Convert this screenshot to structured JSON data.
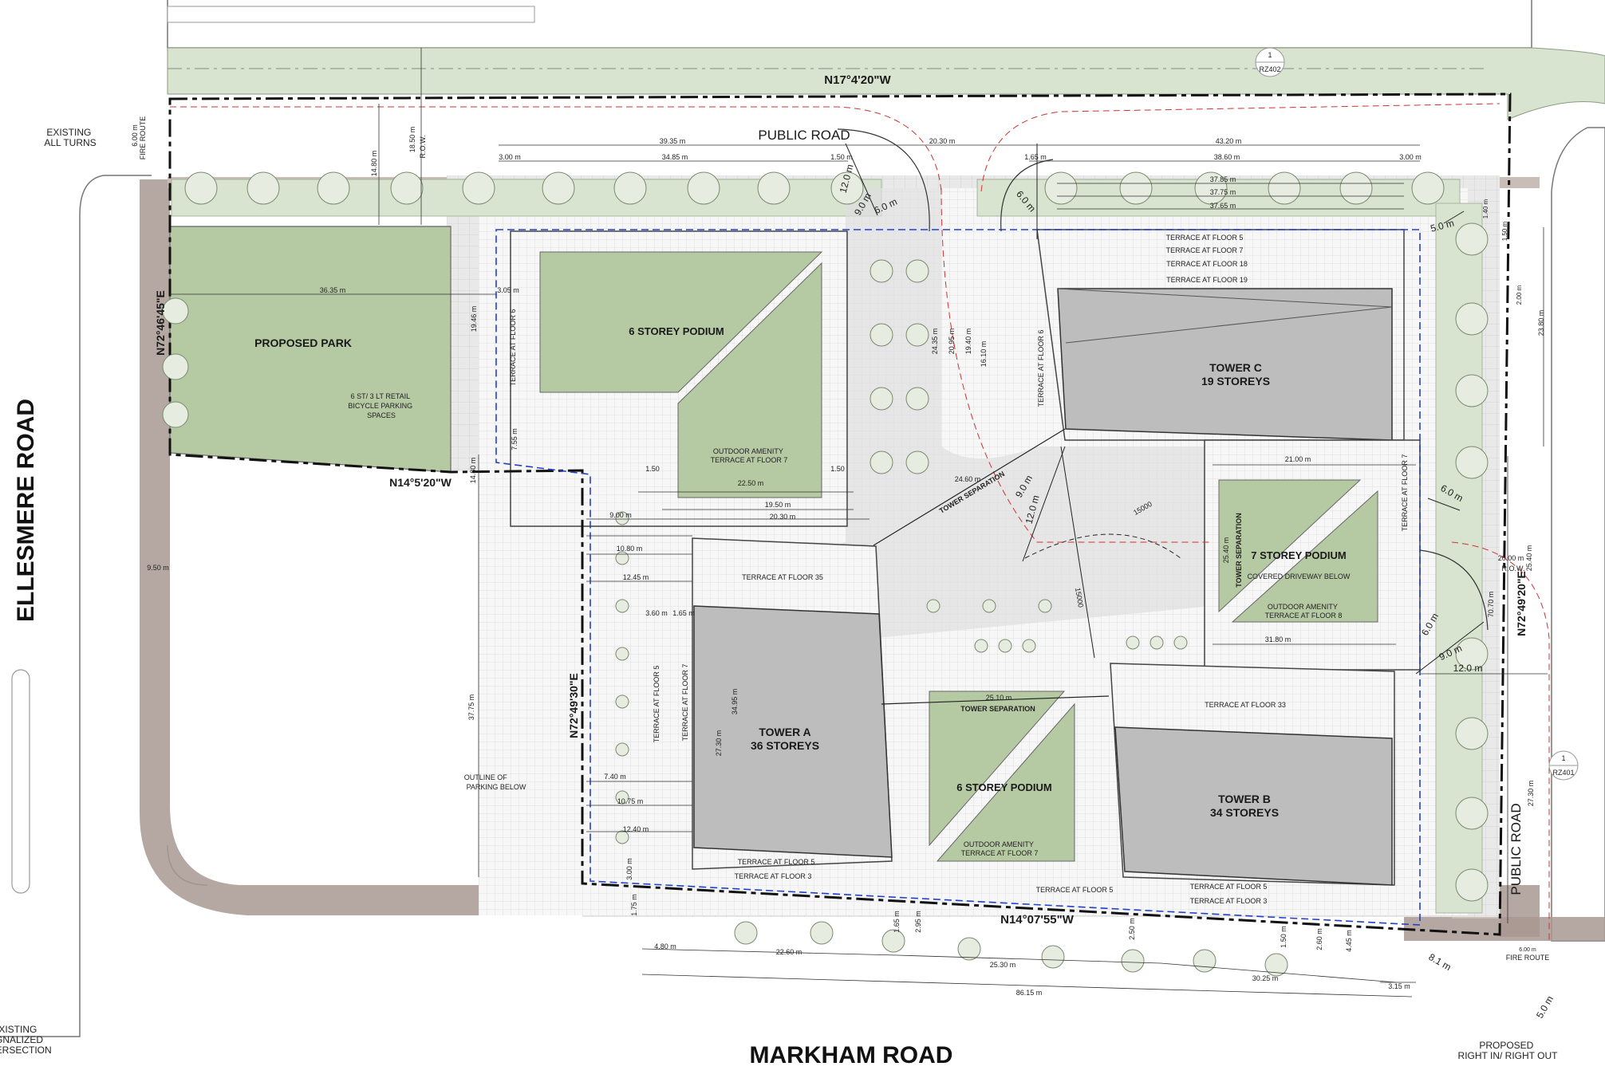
{
  "roads": {
    "west": "ELLESMERE ROAD",
    "south": "MARKHAM ROAD",
    "north": "PUBLIC ROAD",
    "east": "PUBLIC ROAD"
  },
  "bearings": {
    "north": "N17°4'20\"W",
    "south": "N14°07'55\"W",
    "park_south": "N14°5'20\"W",
    "park_west": "N72°46'45\"E",
    "west_inner": "N72°49'30\"E",
    "east": "N72°49'20\"E"
  },
  "notes": {
    "existing_all_turns": [
      "EXISTING",
      "ALL TURNS"
    ],
    "existing_signalized": [
      "EXISTING",
      "SIGNALIZED",
      "INTERSECTION"
    ],
    "proposed_right": [
      "PROPOSED",
      "RIGHT IN/ RIGHT OUT"
    ],
    "bike_parking": [
      "6 ST/ 3 LT RETAIL",
      "BICYCLE PARKING",
      "SPACES"
    ],
    "outline_parking": [
      "OUTLINE OF",
      "PARKING BELOW"
    ],
    "fire_route": "FIRE ROUTE",
    "row": "R.O.W."
  },
  "park": {
    "label": "PROPOSED PARK"
  },
  "tower_a": {
    "name": "TOWER A",
    "storeys": "36 STOREYS"
  },
  "tower_b": {
    "name": "TOWER B",
    "storeys": "34 STOREYS"
  },
  "tower_c": {
    "name": "TOWER C",
    "storeys": "19 STOREYS"
  },
  "podium_nw": {
    "label": "6 STOREY PODIUM",
    "amenity": [
      "OUTDOOR AMENITY",
      "TERRACE AT FLOOR 7"
    ]
  },
  "podium_s": {
    "label": "6 STOREY PODIUM",
    "amenity": [
      "OUTDOOR AMENITY",
      "TERRACE AT FLOOR 7"
    ]
  },
  "podium_e": {
    "label": "7 STOREY PODIUM",
    "covered": "COVERED DRIVEWAY BELOW",
    "amenity": [
      "OUTDOOR AMENITY",
      "TERRACE AT FLOOR 8"
    ]
  },
  "terraces": {
    "c5": "TERRACE AT FLOOR 5",
    "c7": "TERRACE AT FLOOR 7",
    "c18": "TERRACE AT FLOOR 18",
    "c19": "TERRACE AT FLOOR 19",
    "nw6": "TERRACE AT FLOOR 6",
    "c6": "TERRACE AT FLOOR 6",
    "e7": "TERRACE AT FLOOR 7",
    "a35": "TERRACE AT FLOOR 35",
    "a5v": "TERRACE AT FLOOR 5",
    "a7v": "TERRACE AT FLOOR 7",
    "a5": "TERRACE AT FLOOR 5",
    "a3": "TERRACE AT FLOOR 3",
    "b33": "TERRACE AT FLOOR 33",
    "b5": "TERRACE AT FLOOR 5",
    "b3": "TERRACE AT FLOOR 3",
    "s5": "TERRACE AT FLOOR 5"
  },
  "tower_sep": "TOWER SEPARATION",
  "radii": [
    "15000",
    "15000"
  ],
  "dims": {
    "d3935": "39.35 m",
    "d2030": "20.30 m",
    "d4320": "43.20 m",
    "d300a": "3.00 m",
    "d3485": "34.85 m",
    "d150a": "1.50 m",
    "d165a": "1.65 m",
    "d3860": "38.60 m",
    "d300b": "3.00 m",
    "d3785": "37.85 m",
    "d3775": "37.75 m",
    "d3765": "37.65 m",
    "d3635": "36.35 m",
    "d305": "3.05 m",
    "d1946": "19.46 m",
    "d1480": "14.80 m",
    "d1850": "18.50 m",
    "d600v": "6.00 m",
    "d2250": "22.50 m",
    "d1950": "19.50 m",
    "d150b": "1.50",
    "d150c": "1.50",
    "d2030b": "20.30 m",
    "d900": "9.00 m",
    "d1080": "10.80 m",
    "d1245": "12.45 m",
    "d360": "3.60 m",
    "d165b": "1.65 m",
    "d3495": "34.95 m",
    "d2730": "27.30 m",
    "d3775v": "37.75 m",
    "d740": "7.40 m",
    "d1075": "10.75 m",
    "d1240": "12.40 m",
    "d755": "7.55 m",
    "d1480b": "14.80 m",
    "d950": "9.50 m",
    "d2435": "24.35 m",
    "d2095": "20.95 m",
    "d1940": "19.40 m",
    "d1610": "16.10 m",
    "d2460": "24.60 m",
    "d2100": "21.00 m",
    "d2540": "25.40 m",
    "d3180": "31.80 m",
    "d2510": "25.10 m",
    "d2380": "23.80 m",
    "d2000": "20.00 m",
    "d7070": "70.70 m",
    "d2540e": "25.40 m",
    "d2730e": "27.30 m",
    "d480": "4.80 m",
    "d2260": "22.60 m",
    "d2530": "25.30 m",
    "d3025": "30.25 m",
    "d8615": "86.15 m",
    "d315": "3.15 m",
    "d175": "1.75 m",
    "d300s": "3.00 m",
    "d165s": "1.65 m",
    "d295": "2.95 m",
    "d250": "2.50 m",
    "d150s": "1.50 m",
    "d260": "2.60 m",
    "d445": "4.45 m",
    "d600fr": "6.00 m",
    "d140": "1.40 m",
    "d150e": "1.50 m",
    "d200e": "2.00 m",
    "r120a": "12.0 m",
    "r90a": "9.0 m",
    "r60a": "6.0 m",
    "r60b": "6.0 m",
    "r50a": "5.0 m",
    "r90b": "9.0 m",
    "r120b": "12.0 m",
    "r60c": "6.0 m",
    "r60d": "6.0 m",
    "r90c": "9.0 m",
    "r120c": "12.0 m",
    "r81": "8.1 m",
    "r50b": "5.0 m"
  },
  "section_marks": {
    "n": "RZ402",
    "e": "RZ401",
    "num": "1"
  },
  "colors": {
    "green": "#b5c9a3",
    "light_green": "#d8e4cf",
    "tower": "#bdbdbd",
    "sidewalk": "#a89890",
    "road": "#f2f2f2"
  }
}
